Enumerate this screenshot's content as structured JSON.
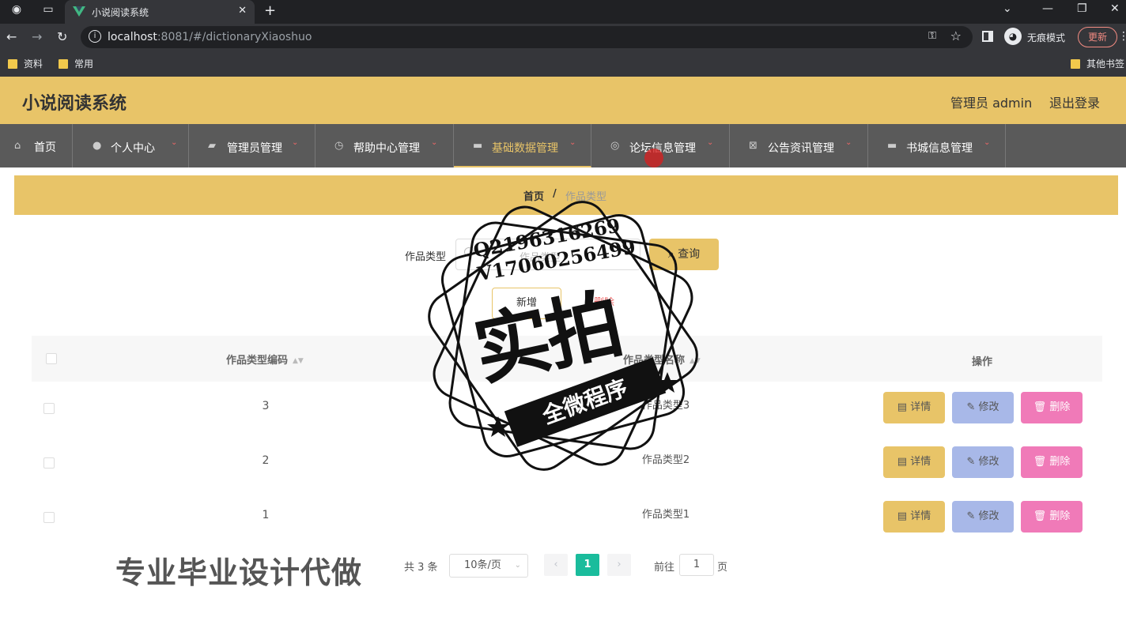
{
  "browser": {
    "tab_title": "小说阅读系统",
    "url_host": "localhost",
    "url_rest": ":8081/#/dictionaryXiaoshuo",
    "incognito_label": "无痕模式",
    "update_label": "更新",
    "bookmarks": [
      "资料",
      "常用"
    ],
    "other_bookmarks": "其他书签",
    "icons": {
      "back": "back-arrow-icon",
      "forward": "forward-arrow-icon",
      "reload": "reload-icon"
    }
  },
  "header": {
    "title": "小说阅读系统",
    "user": "管理员 admin",
    "logout": "退出登录",
    "bg_color": "#e8c468"
  },
  "nav": {
    "items": [
      {
        "label": "首页"
      },
      {
        "label": "个人中心"
      },
      {
        "label": "管理员管理"
      },
      {
        "label": "帮助中心管理"
      },
      {
        "label": "基础数据管理"
      },
      {
        "label": "论坛信息管理"
      },
      {
        "label": "公告资讯管理"
      },
      {
        "label": "书城信息管理"
      }
    ],
    "active_index": 4
  },
  "breadcrumb": {
    "home": "首页",
    "separator": "/",
    "current": "作品类型"
  },
  "search": {
    "label": "作品类型",
    "placeholder": "作品类型",
    "button": "查询"
  },
  "actions": {
    "add": "新增",
    "batch_delete": "删除"
  },
  "table": {
    "headers": {
      "code": "作品类型编码",
      "name": "作品类型名称",
      "ops": "操作"
    },
    "rows": [
      {
        "code": "3",
        "name": "作品类型3"
      },
      {
        "code": "2",
        "name": "作品类型2"
      },
      {
        "code": "1",
        "name": "作品类型1"
      }
    ],
    "row_actions": {
      "detail": "详情",
      "edit": "修改",
      "delete": "删除"
    }
  },
  "pagination": {
    "total": "共 3 条",
    "page_size": "10条/页",
    "current_page": "1",
    "goto_label": "前往",
    "goto_value": "1",
    "page_unit": "页"
  },
  "watermark": {
    "contact": [
      "Q2196316269",
      "V17060256499"
    ],
    "big": "实拍",
    "ribbon": "全微程序",
    "promo": "专业毕业设计代做"
  }
}
